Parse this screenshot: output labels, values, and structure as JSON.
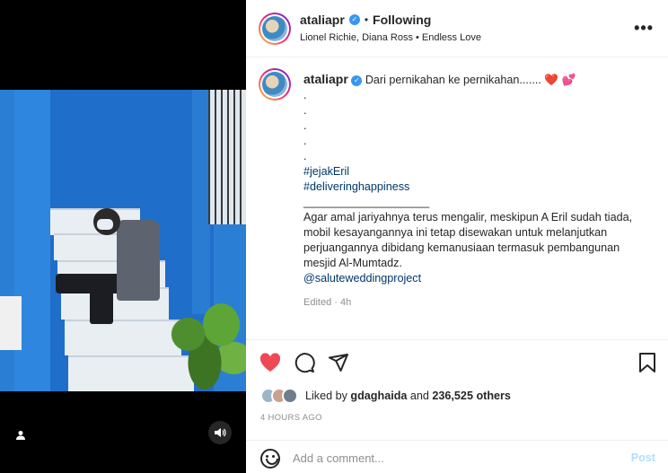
{
  "header": {
    "username": "ataliapr",
    "separator": "•",
    "follow_status": "Following",
    "audio": "Lionel Richie, Diana Ross • Endless Love",
    "more_icon": "more-horizontal-icon"
  },
  "caption": {
    "username": "ataliapr",
    "text": "Dari pernikahan ke pernikahan.......",
    "emoji_1": "❤️",
    "emoji_2": "💕",
    "dots": [
      ".",
      ".",
      ".",
      ".",
      "."
    ],
    "hashtags": [
      "#jejakEril",
      "#deliveringhappiness"
    ],
    "divider": "____________________",
    "body_lines": [
      "Agar amal jariyahnya terus mengalir, meskipun A Eril sudah tiada,",
      "mobil kesayangannya ini tetap disewakan untuk melanjutkan",
      "perjuangannya dibidang kemanusiaan termasuk pembangunan",
      "mesjid Al-Mumtadz."
    ],
    "mention": "@saluteweddingproject",
    "edited": "Edited · 4h"
  },
  "actions": {
    "like_icon": "heart-filled-icon",
    "comment_icon": "comment-icon",
    "share_icon": "paper-plane-icon",
    "save_icon": "bookmark-icon",
    "like_color": "#ed4956"
  },
  "likes": {
    "prefix": "Liked by",
    "user": "gdaghaida",
    "middle": "and",
    "count": "236,525 others"
  },
  "timestamp": "4 HOURS AGO",
  "comment": {
    "placeholder": "Add a comment...",
    "post_label": "Post"
  },
  "media": {
    "user_tag_icon": "person-icon",
    "audio_icon": "speaker-icon"
  }
}
